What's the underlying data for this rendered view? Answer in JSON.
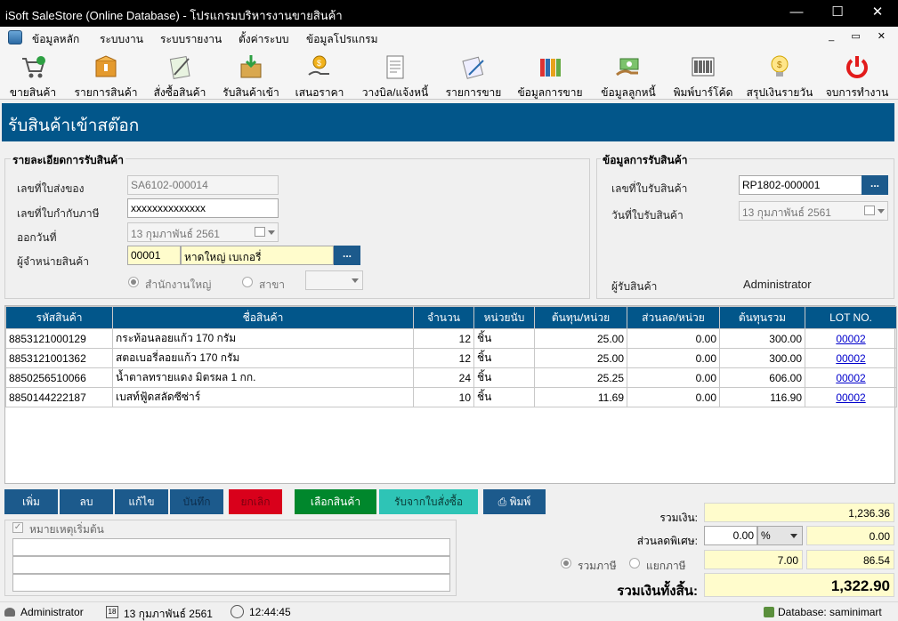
{
  "window": {
    "title": "iSoft SaleStore (Online Database) - โปรแกรมบริหารงานขายสินค้า"
  },
  "menu": [
    "ข้อมูลหลัก",
    "ระบบงาน",
    "ระบบรายงาน",
    "ตั้งค่าระบบ",
    "ข้อมูลโปรแกรม"
  ],
  "toolbar": [
    {
      "label": "ขายสินค้า",
      "icon": "cart-icon"
    },
    {
      "label": "รายการสินค้า",
      "icon": "box-icon"
    },
    {
      "label": "สั่งซื้อสินค้า",
      "icon": "order-icon"
    },
    {
      "label": "รับสินค้าเข้า",
      "icon": "receive-icon"
    },
    {
      "label": "เสนอราคา",
      "icon": "quote-icon"
    },
    {
      "label": "วางบิล/แจ้งหนี้",
      "icon": "invoice-icon"
    },
    {
      "label": "รายการขาย",
      "icon": "sales-list-icon"
    },
    {
      "label": "ข้อมูลการขาย",
      "icon": "sales-data-icon"
    },
    {
      "label": "ข้อมูลลูกหนี้",
      "icon": "debtor-icon"
    },
    {
      "label": "พิมพ์บาร์โค้ด",
      "icon": "barcode-icon"
    },
    {
      "label": "สรุปเงินรายวัน",
      "icon": "daily-summary-icon"
    },
    {
      "label": "จบการทำงาน",
      "icon": "power-icon"
    }
  ],
  "form": {
    "title": "รับสินค้าเข้าสต๊อก",
    "detail_title": "รายละเอียดการรับสินค้า",
    "delivery_no_label": "เลขที่ใบส่งของ",
    "delivery_no": "SA6102-000014",
    "tax_no_label": "เลขที่ใบกำกับภาษี",
    "tax_no": "xxxxxxxxxxxxxx",
    "issue_date_label": "ออกวันที่",
    "issue_date": "13  กุมภาพันธ์   2561",
    "supplier_label": "ผู้จำหน่ายสินค้า",
    "supplier_code": "00001",
    "supplier_name": "หาดใหญ่ เบเกอรี่",
    "hq_label": "สำนักงานใหญ่",
    "branch_label": "สาขา",
    "info_title": "ข้อมูลการรับสินค้า",
    "receipt_no_label": "เลขที่ใบรับสินค้า",
    "receipt_no": "RP1802-000001",
    "receipt_date_label": "วันที่ใบรับสินค้า",
    "receipt_date": "13  กุมภาพันธ์   2561",
    "receiver_label": "ผู้รับสินค้า",
    "receiver": "Administrator",
    "dots": "..."
  },
  "grid": {
    "columns": [
      "รหัสสินค้า",
      "ชื่อสินค้า",
      "จำนวน",
      "หน่วยนับ",
      "ต้นทุน/หน่วย",
      "ส่วนลด/หน่วย",
      "ต้นทุนรวม",
      "LOT NO."
    ],
    "rows": [
      [
        "8853121000129",
        "กระท้อนลอยแก้ว 170 กรัม",
        "12",
        "ชิ้น",
        "25.00",
        "0.00",
        "300.00",
        "00002"
      ],
      [
        "8853121001362",
        "สตอเบอรี่ลอยแก้ว 170 กรัม",
        "12",
        "ชิ้น",
        "25.00",
        "0.00",
        "300.00",
        "00002"
      ],
      [
        "8850256510066",
        "น้ำตาลทรายแดง มิตรผล 1 กก.",
        "24",
        "ชิ้น",
        "25.25",
        "0.00",
        "606.00",
        "00002"
      ],
      [
        "8850144222187",
        "เบสท์ฟู้ดสลัดซีซ่าร์",
        "10",
        "ชิ้น",
        "11.69",
        "0.00",
        "116.90",
        "00002"
      ]
    ]
  },
  "buttons": {
    "add": "เพิ่ม",
    "delete": "ลบ",
    "edit": "แก้ไข",
    "save": "บันทึก",
    "cancel": "ยกเลิก",
    "select": "เลือกสินค้า",
    "from_order": "รับจากใบสั่งซื้อ",
    "print": "พิมพ์"
  },
  "remarks": {
    "label": "หมายเหตุเริ่มต้น"
  },
  "totals": {
    "sum_label": "รวมเงิน:",
    "sum": "1,236.36",
    "discount_label": "ส่วนลดพิเศษ:",
    "discount_value": "0.00",
    "discount_unit": "%",
    "discount_amount": "0.00",
    "vat_in_label": "รวมภาษี",
    "vat_ex_label": "แยกภาษี",
    "vat_rate": "7.00",
    "vat_amount": "86.54",
    "grand_label": "รวมเงินทั้งสิ้น:",
    "grand": "1,322.90"
  },
  "status": {
    "user": "Administrator",
    "date": "13 กุมภาพันธ์ 2561",
    "time": "12:44:45",
    "database": "Database: saminimart"
  },
  "colors": {
    "accent": "#02568a",
    "yellow_field": "#fffccc",
    "cancel_btn": "#d9001b",
    "select_btn": "#00872c",
    "order_btn": "#2ec4b6"
  }
}
